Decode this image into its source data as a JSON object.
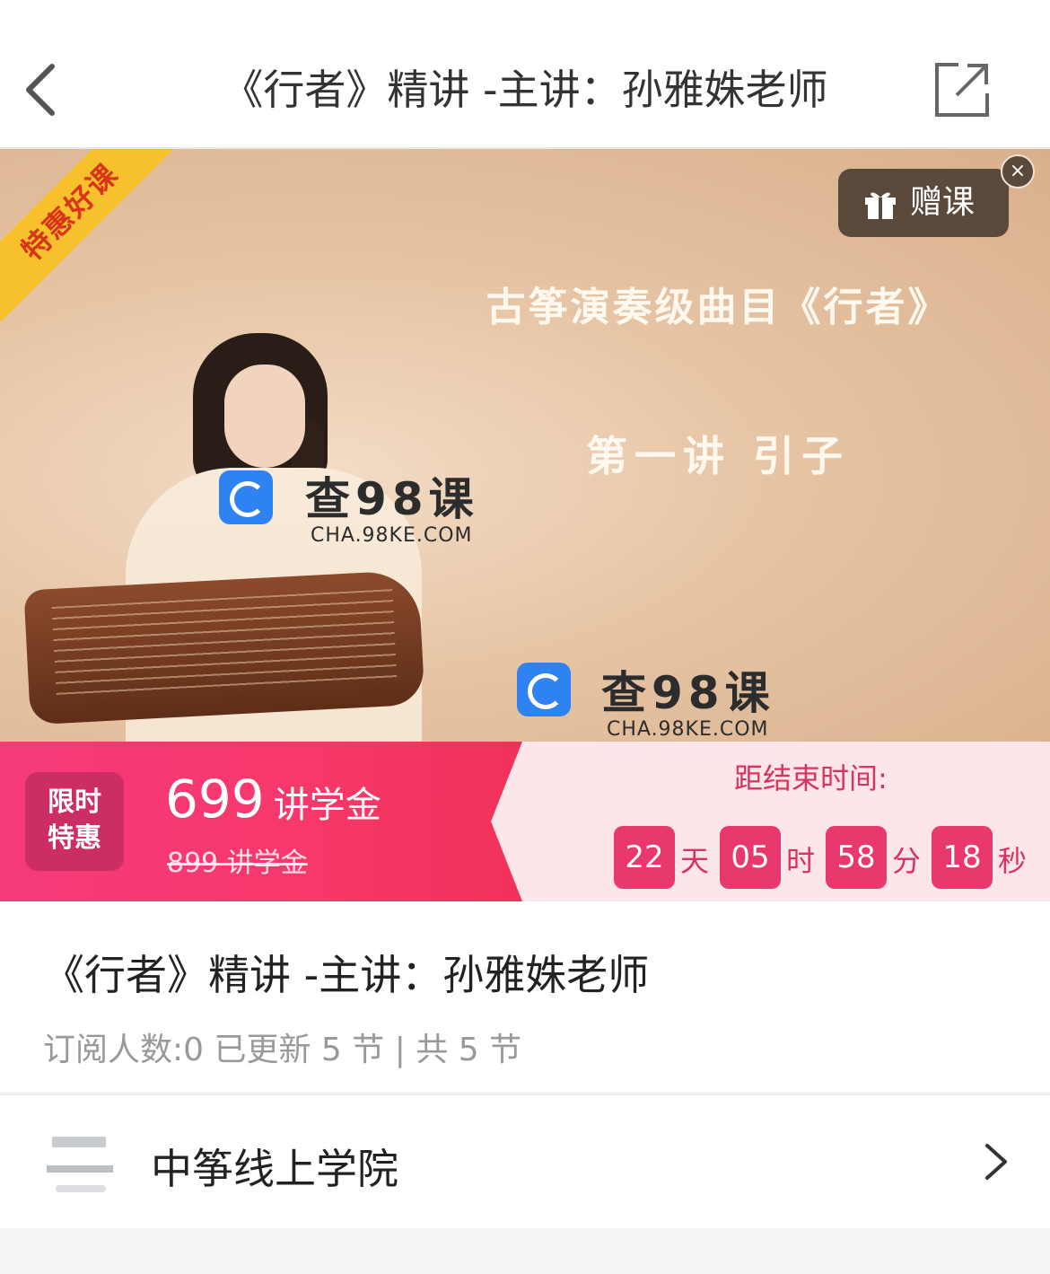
{
  "header": {
    "title": "《行者》精讲 -主讲：孙雅姝老师",
    "back_icon": "chevron-left-icon",
    "share_icon": "external-share-icon"
  },
  "banner": {
    "ribbon": "特惠好课",
    "gift_label": "赠课",
    "gift_close": "×",
    "headline": "古筝演奏级曲目《行者》",
    "subline": "第一讲  引子",
    "watermark_cn": "查98课",
    "watermark_en": "CHA.98KE.COM"
  },
  "promo": {
    "tag_line1": "限时",
    "tag_line2": "特惠",
    "price": "699",
    "price_unit": "讲学金",
    "old_price": "899 讲学金",
    "countdown_label": "距结束时间:",
    "days": "22",
    "days_unit": "天",
    "hours": "05",
    "hours_unit": "时",
    "minutes": "58",
    "minutes_unit": "分",
    "seconds": "18",
    "seconds_unit": "秒"
  },
  "course": {
    "title": "《行者》精讲 -主讲：孙雅姝老师",
    "meta": "订阅人数:0 已更新 5 节 | 共 5 节"
  },
  "provider": {
    "name": "中筝线上学院"
  },
  "colors": {
    "accent_pink": "#f6386a",
    "countdown_box": "#e8386c",
    "ribbon_yellow": "#f6c12c",
    "gift_button": "#5b4a3c"
  }
}
